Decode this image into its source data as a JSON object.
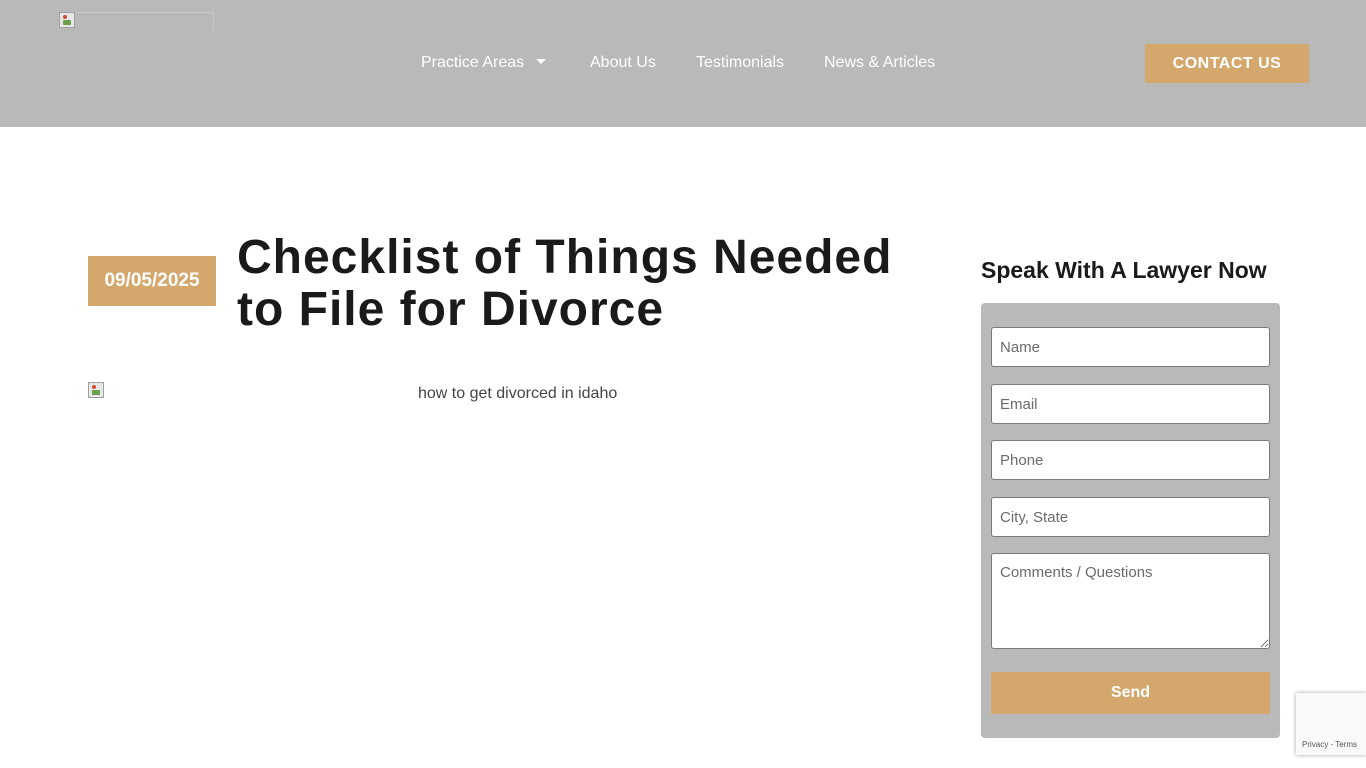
{
  "header": {
    "nav": [
      {
        "label": "Practice Areas",
        "has_dropdown": true
      },
      {
        "label": "About Us"
      },
      {
        "label": "Testimonials"
      },
      {
        "label": "News & Articles"
      }
    ],
    "contact_label": "CONTACT US"
  },
  "article": {
    "date": "09/05/2025",
    "title": "Checklist of Things Needed to File for Divorce",
    "image_alt": "how to get divorced in idaho"
  },
  "sidebar": {
    "title": "Speak With A Lawyer Now",
    "fields": {
      "name_placeholder": "Name",
      "email_placeholder": "Email",
      "phone_placeholder": "Phone",
      "city_placeholder": "City, State",
      "comments_placeholder": "Comments / Questions"
    },
    "send_label": "Send"
  },
  "recaptcha": {
    "privacy": "Privacy",
    "separator": "-",
    "terms": "Terms"
  },
  "colors": {
    "header_bg": "#b9b9b9",
    "accent": "#d4a76c",
    "title_text": "#1a1a1a"
  }
}
